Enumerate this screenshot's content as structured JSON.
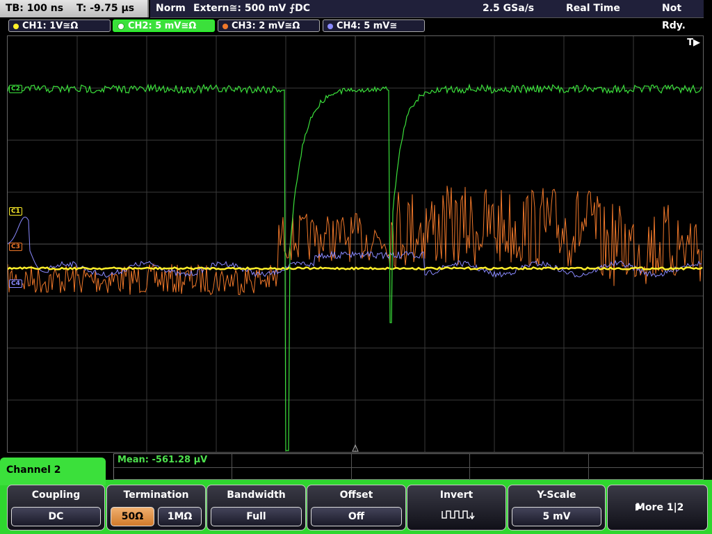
{
  "status": {
    "timebase": "TB: 100 ns",
    "trigger_time": "T: -9.75 µs",
    "mode": "Norm",
    "trigger_source": "Extern≅: 500 mV ⨍DC",
    "sample_rate": "2.5 GSa/s",
    "acq_mode": "Real Time",
    "run_state": "Not Rdy."
  },
  "channels": [
    {
      "label": "CH1: 1V≅Ω",
      "color": "#ffef2a",
      "marker": "C1"
    },
    {
      "label": "CH2: 5 mV≅Ω",
      "color": "#3be03b",
      "marker": "C2"
    },
    {
      "label": "CH3: 2 mV≅Ω",
      "color": "#f0782a",
      "marker": "C3"
    },
    {
      "label": "CH4: 5 mV≅",
      "color": "#8a8aff",
      "marker": "C4"
    }
  ],
  "trigger_marker": "T▶",
  "measurement": {
    "label": "Mean: -561.28 µV"
  },
  "panel": {
    "title": "Channel 2"
  },
  "softkeys": {
    "coupling": {
      "title": "Coupling",
      "value": "DC"
    },
    "termination": {
      "title": "Termination",
      "opt1": "50Ω",
      "opt2": "1MΩ"
    },
    "bandwidth": {
      "title": "Bandwidth",
      "value": "Full"
    },
    "offset": {
      "title": "Offset",
      "value": "Off"
    },
    "invert": {
      "title": "Invert",
      "icon": "invert-waveform-icon"
    },
    "yscale": {
      "title": "Y-Scale",
      "value": "5 mV"
    },
    "more": {
      "label": "More 1|2",
      "icon": "right-arrow-icon"
    }
  }
}
